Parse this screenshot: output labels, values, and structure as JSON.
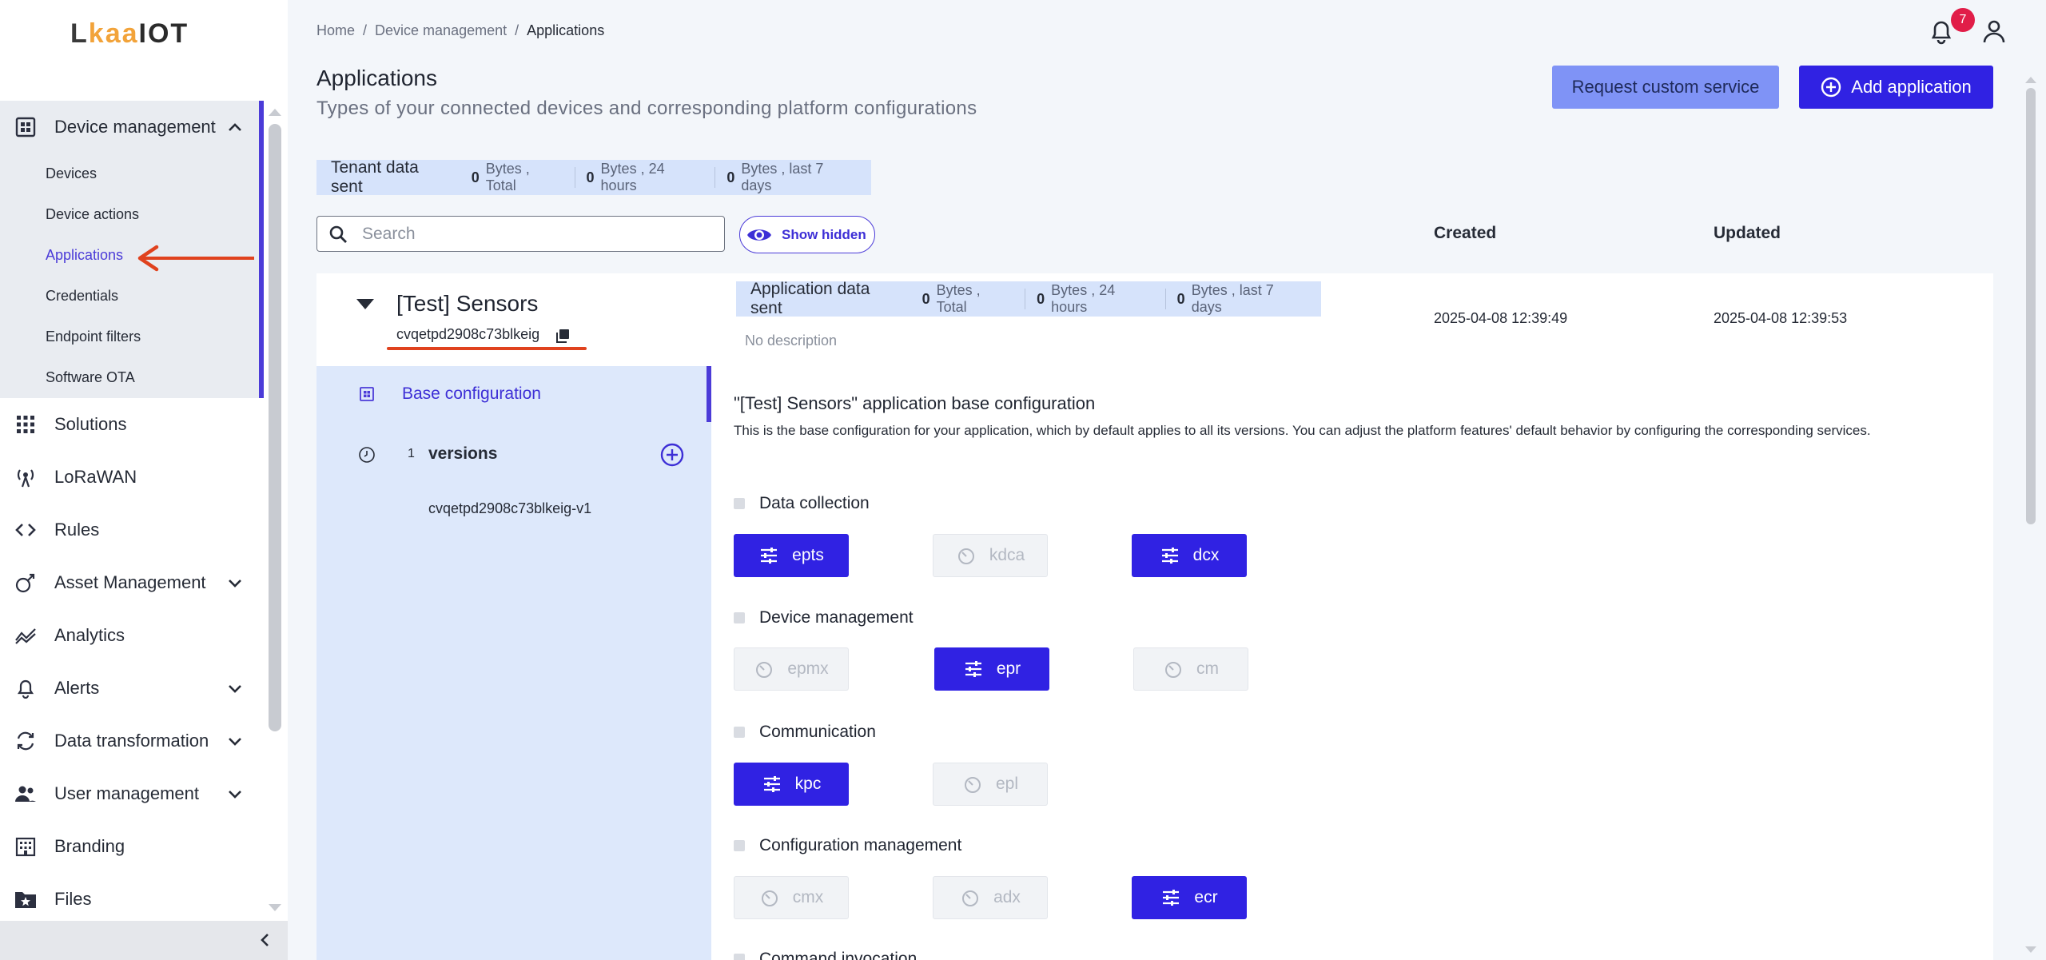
{
  "brand": {
    "logo_text_1": "L",
    "logo_text_2": "ka",
    "logo_text_3": "a",
    "logo_text_4": "IOT"
  },
  "sidebar": {
    "device_management": {
      "label": "Device management",
      "sub": [
        "Devices",
        "Device actions",
        "Applications",
        "Credentials",
        "Endpoint filters",
        "Software OTA"
      ]
    },
    "items": [
      {
        "label": "Solutions"
      },
      {
        "label": "LoRaWAN"
      },
      {
        "label": "Rules"
      },
      {
        "label": "Asset Management"
      },
      {
        "label": "Analytics"
      },
      {
        "label": "Alerts"
      },
      {
        "label": "Data transformation"
      },
      {
        "label": "User management"
      },
      {
        "label": "Branding"
      },
      {
        "label": "Files"
      }
    ]
  },
  "breadcrumb": {
    "home": "Home",
    "sep": "/",
    "level1": "Device management",
    "current": "Applications"
  },
  "header": {
    "title": "Applications",
    "subtitle": "Types of your connected devices and corresponding platform configurations",
    "notification_count": "7",
    "request_label": "Request custom service",
    "add_label": "Add application"
  },
  "tenant_stats": {
    "label": "Tenant data sent",
    "total_value": "0",
    "total_unit": "Bytes , Total",
    "day_value": "0",
    "day_unit": "Bytes , 24 hours",
    "week_value": "0",
    "week_unit": "Bytes , last 7 days"
  },
  "search": {
    "placeholder": "Search",
    "value": ""
  },
  "show_hidden_label": "Show hidden",
  "columns": {
    "created": "Created",
    "updated": "Updated"
  },
  "application": {
    "name": "[Test] Sensors",
    "id": "cvqetpd2908c73blkeig",
    "description": "No description",
    "created": "2025-04-08 12:39:49",
    "updated": "2025-04-08 12:39:53",
    "stats": {
      "label": "Application data sent",
      "total_value": "0",
      "total_unit": "Bytes , Total",
      "day_value": "0",
      "day_unit": "Bytes , 24 hours",
      "week_value": "0",
      "week_unit": "Bytes , last 7 days"
    }
  },
  "left_panel": {
    "base_label": "Base configuration",
    "versions_count": "1",
    "versions_label": "versions",
    "version_item": "cvqetpd2908c73blkeig-v1"
  },
  "config": {
    "title": "\"[Test] Sensors\" application base configuration",
    "description": "This is the base configuration for your application, which by default applies to all its versions. You can adjust the platform features' default behavior by configuring the corresponding services.",
    "sections": [
      {
        "title": "Data collection",
        "services": [
          {
            "name": "epts",
            "on": true
          },
          {
            "name": "kdca",
            "on": false
          },
          {
            "name": "dcx",
            "on": true
          }
        ]
      },
      {
        "title": "Device management",
        "services": [
          {
            "name": "epmx",
            "on": false
          },
          {
            "name": "epr",
            "on": true
          },
          {
            "name": "cm",
            "on": false
          }
        ]
      },
      {
        "title": "Communication",
        "services": [
          {
            "name": "kpc",
            "on": true
          },
          {
            "name": "epl",
            "on": false
          }
        ]
      },
      {
        "title": "Configuration management",
        "services": [
          {
            "name": "cmx",
            "on": false
          },
          {
            "name": "adx",
            "on": false
          },
          {
            "name": "ecr",
            "on": true
          }
        ]
      },
      {
        "title": "Command invocation",
        "services": []
      }
    ]
  },
  "colors": {
    "accent": "#3022e3",
    "accent_light": "#7f93f6",
    "panel": "#dde8fb",
    "badge": "#e11d48",
    "annotation": "#e0421e"
  }
}
